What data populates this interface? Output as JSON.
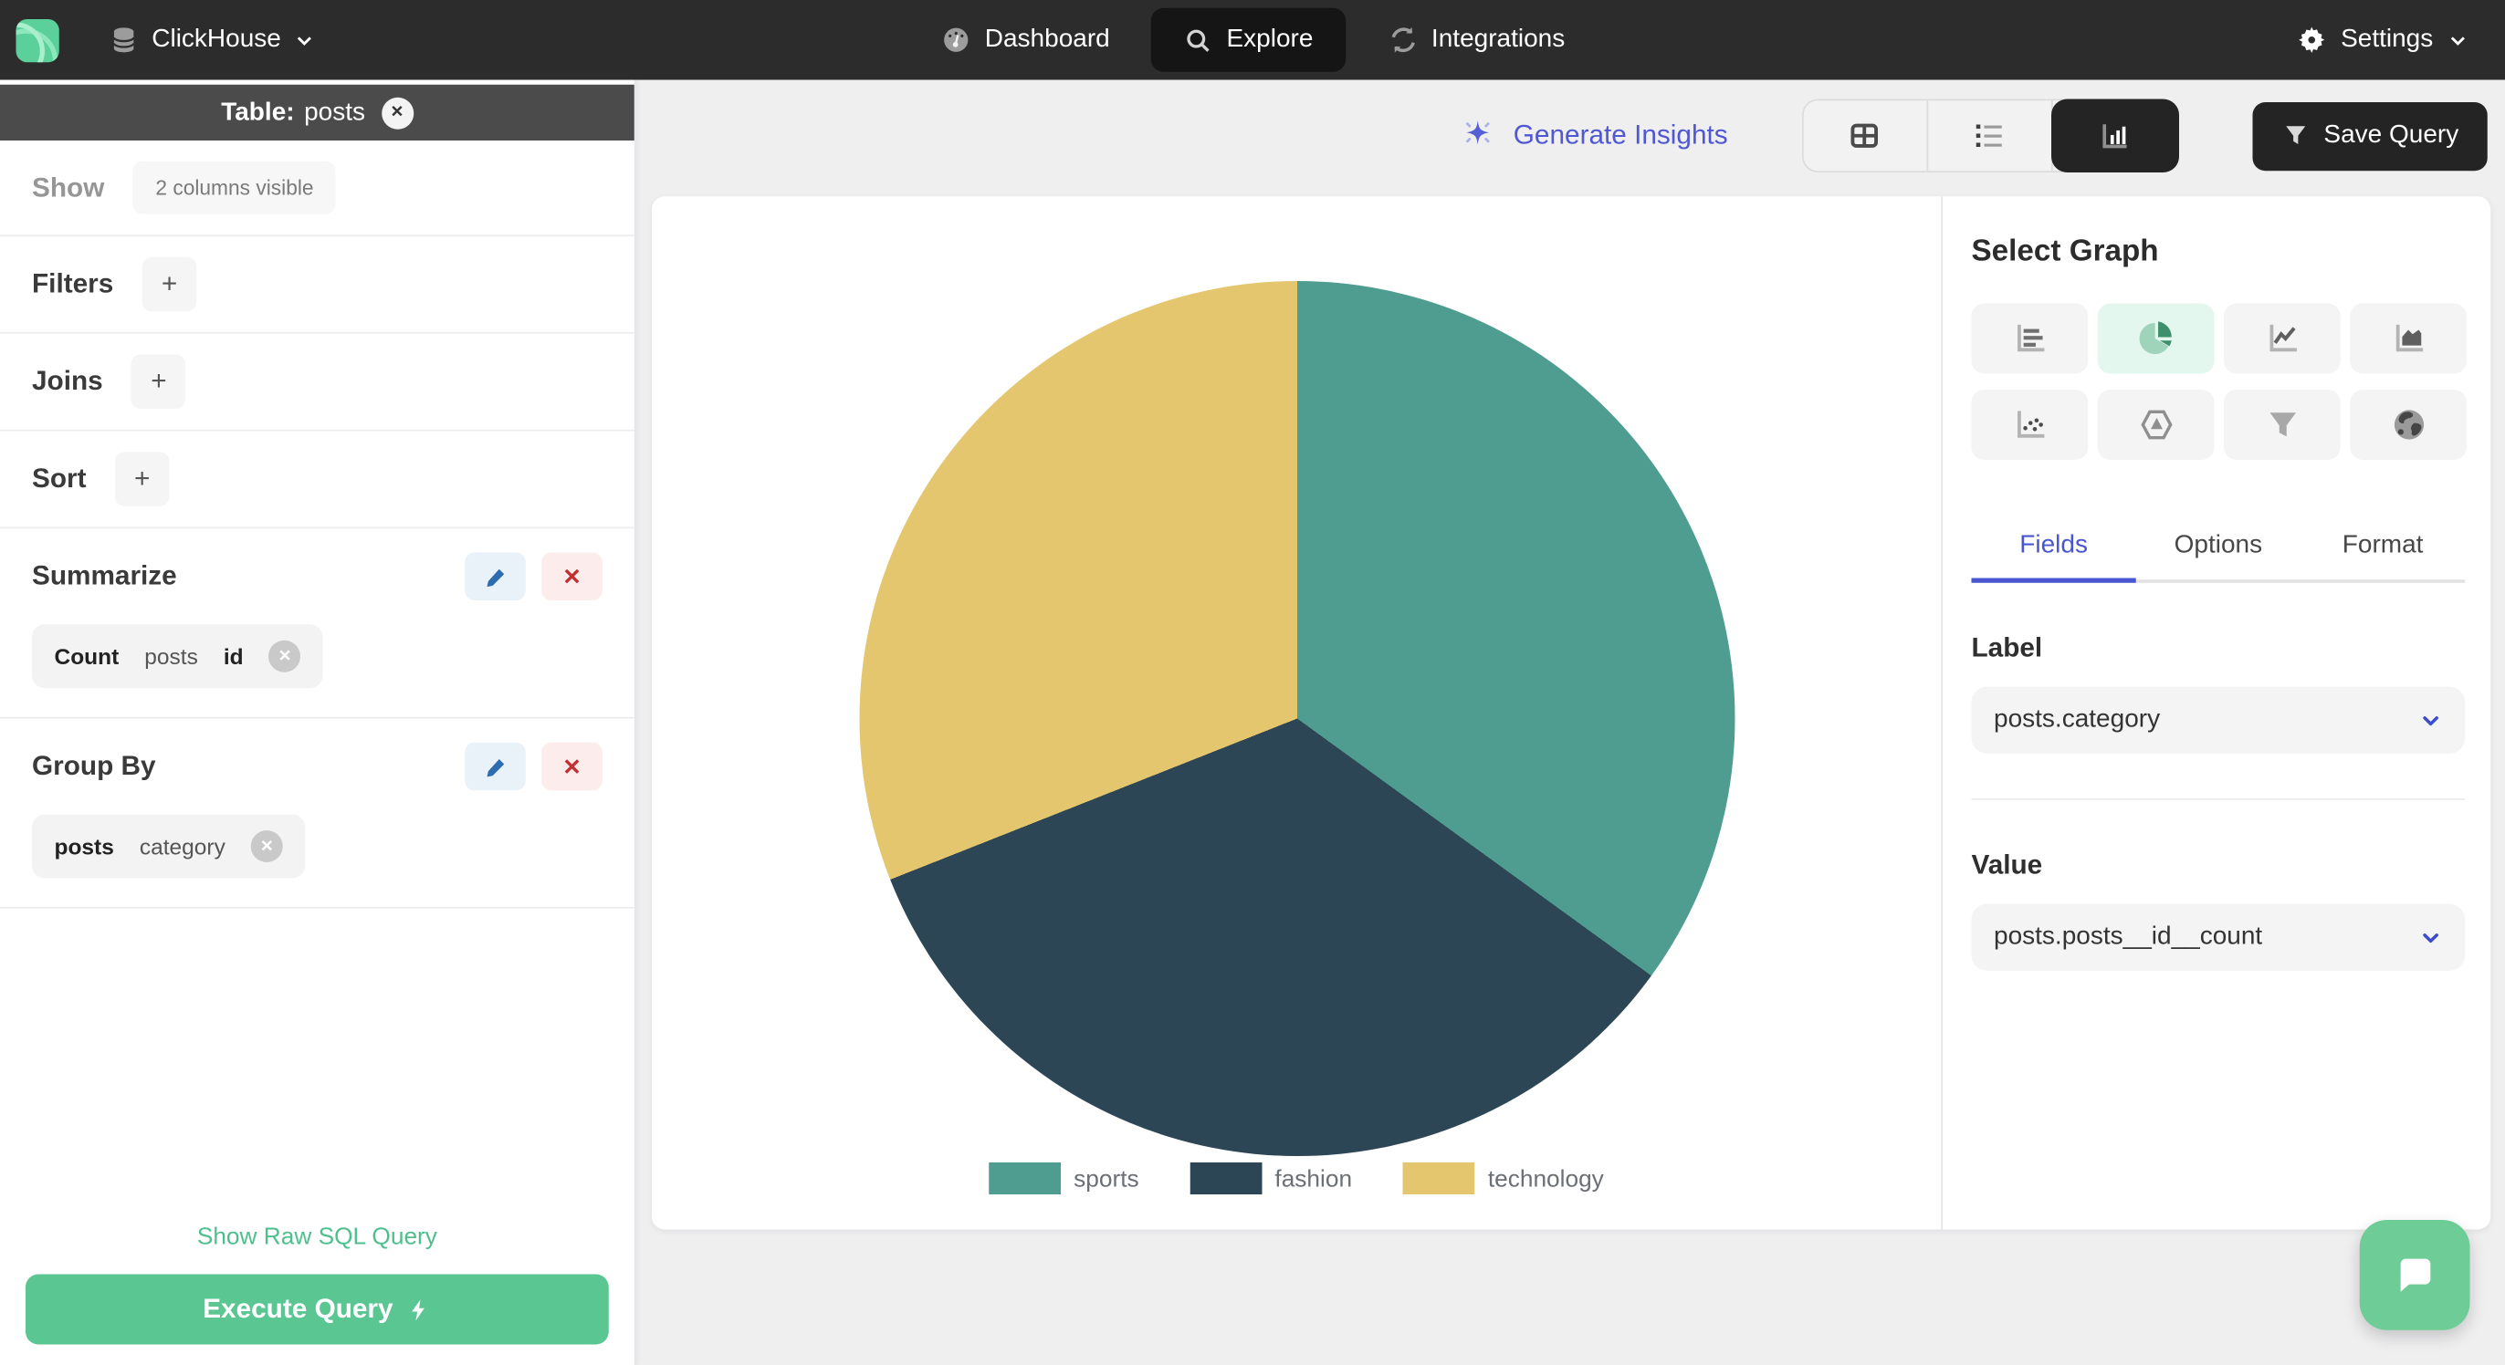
{
  "navbar": {
    "brand": "ClickHouse",
    "dashboard": "Dashboard",
    "explore": "Explore",
    "integrations": "Integrations",
    "settings": "Settings"
  },
  "sidebar": {
    "table_label": "Table:",
    "table_name": "posts",
    "show_label": "Show",
    "show_summary": "2 columns visible",
    "filters_label": "Filters",
    "joins_label": "Joins",
    "sort_label": "Sort",
    "add_button": "+",
    "summarize": {
      "title": "Summarize",
      "chip": {
        "agg": "Count",
        "table": "posts",
        "column": "id"
      }
    },
    "group_by": {
      "title": "Group By",
      "chip": {
        "table": "posts",
        "column": "category"
      }
    },
    "raw_sql_link": "Show Raw SQL Query",
    "execute_button": "Execute Query"
  },
  "toolbar": {
    "generate_insights": "Generate Insights",
    "save_query": "Save Query"
  },
  "graph_panel": {
    "title": "Select Graph",
    "options": [
      "bar-chart",
      "pie-chart",
      "line-chart",
      "area-chart",
      "scatter-plot",
      "graph",
      "funnel",
      "map"
    ],
    "selected_option": "pie-chart",
    "tabs": {
      "fields": "Fields",
      "options": "Options",
      "format": "Format"
    },
    "active_tab": "Fields",
    "label_title": "Label",
    "label_value": "posts.category",
    "value_title": "Value",
    "value_value": "posts.posts__id__count"
  },
  "chart_data": {
    "type": "pie",
    "title": "",
    "categories": [
      "sports",
      "fashion",
      "technology"
    ],
    "values": [
      35,
      34,
      31
    ],
    "colors": [
      "#4e9d90",
      "#2d4656",
      "#e4c66f"
    ],
    "legend_position": "bottom"
  },
  "theme": {
    "accent_blue": "#4a55d2",
    "accent_green": "#5ac692",
    "navbar_bg": "#2c2c2c",
    "selected_graph_bg": "#e3f7ee"
  }
}
